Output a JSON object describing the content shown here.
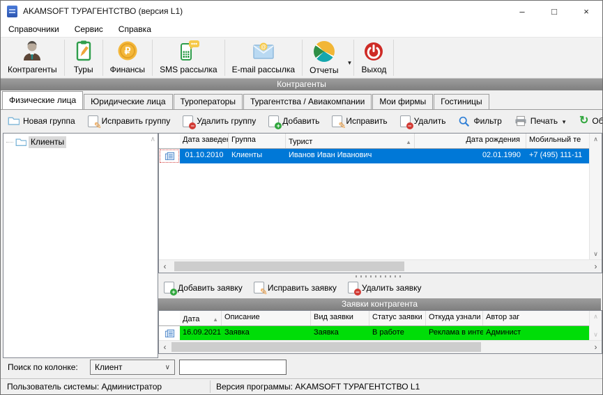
{
  "window": {
    "title": "AKAMSOFT ТУРАГЕНТСТВО (версия  L1)"
  },
  "icons": {
    "minimize": "–",
    "maximize": "□",
    "close": "×",
    "dropdown": "▼",
    "sort_asc": "▲",
    "combo_chevron": "∨",
    "scroll_up": "∧",
    "scroll_down": "∨",
    "scroll_left": "‹",
    "scroll_right": "›",
    "refresh": "↻",
    "pencil": "✎",
    "plus": "+",
    "minus": "−"
  },
  "menu": {
    "items": [
      "Справочники",
      "Сервис",
      "Справка"
    ]
  },
  "toolbar": {
    "buttons": [
      "Контрагенты",
      "Туры",
      "Финансы",
      "SMS рассылка",
      "E-mail рассылка",
      "Отчеты",
      "Выход"
    ]
  },
  "caption": "Контрагенты",
  "tabs": [
    "Физические лица",
    "Юридические лица",
    "Туроператоры",
    "Турагентства / Авиакомпании",
    "Мои фирмы",
    "Гостиницы"
  ],
  "group_toolbar": {
    "new_group": "Новая группа",
    "edit_group": "Исправить группу",
    "delete_group": "Удалить группу",
    "add": "Добавить",
    "edit": "Исправить",
    "delete": "Удалить",
    "filter": "Фильтр",
    "print": "Печать",
    "refresh": "Обновить"
  },
  "tree": {
    "root": "Клиенты"
  },
  "contacts_table": {
    "columns": [
      "Дата заведения",
      "Группа",
      "Турист",
      "Дата рождения",
      "Мобильный те"
    ],
    "row": {
      "created": "01.10.2010",
      "group": "Клиенты",
      "tourist": "Иванов Иван Иванович",
      "birthdate": "02.01.1990",
      "mobile": "+7 (495) 111-11"
    }
  },
  "request_toolbar": {
    "add": "Добавить заявку",
    "edit": "Исправить заявку",
    "delete": "Удалить заявку"
  },
  "requests_caption": "Заявки контрагента",
  "requests_table": {
    "columns": [
      "Дата",
      "Описание",
      "Вид заявки",
      "Статус заявки",
      "Откуда узнали",
      "Автор заг"
    ],
    "row": {
      "date": "16.09.2021",
      "description": "Заявка",
      "type": "Заявка",
      "status": "В работе",
      "source": "Реклама в интерн",
      "author": "Админист"
    }
  },
  "search": {
    "label": "Поиск по колонке:",
    "selected_column": "Клиент",
    "query": ""
  },
  "status_bar": {
    "user": "Пользователь системы: Администратор",
    "version": "Версия программы: AKAMSOFT ТУРАГЕНТСТВО  L1"
  },
  "colors": {
    "selection_blue": "#0078d7",
    "row_green": "#00dd08",
    "caption_gray": "#8c8c8c",
    "titlebar_white": "#ffffff"
  }
}
